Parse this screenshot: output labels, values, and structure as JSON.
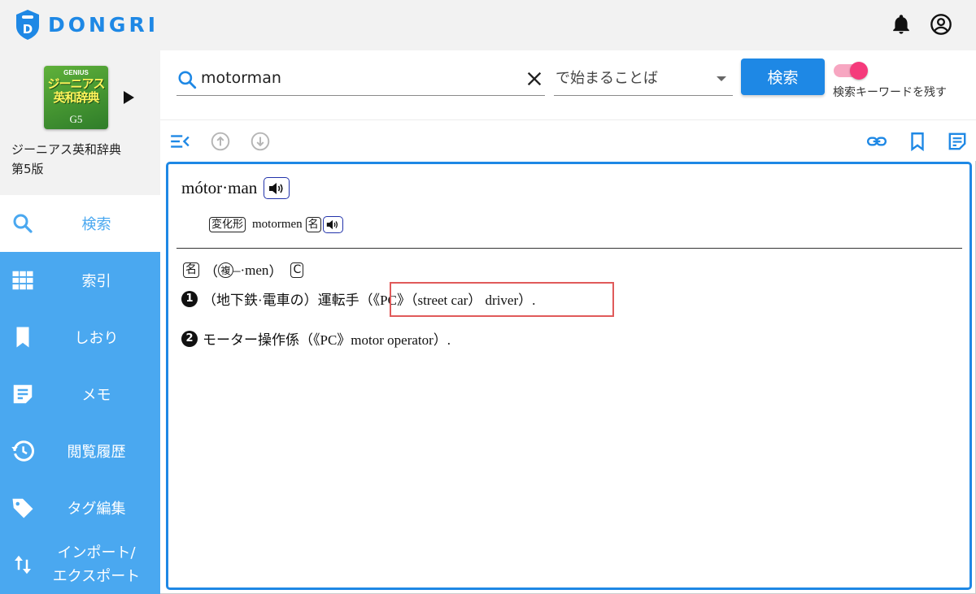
{
  "app": {
    "logo_text": "DONGRI"
  },
  "header": {
    "bell_icon": "bell-icon",
    "account_icon": "account-circle-icon"
  },
  "book": {
    "cover_brand": "GENIUS",
    "cover_title": "ジーニアス英和辞典",
    "cover_edition": "G5",
    "name_line1": "ジーニアス英和辞典",
    "name_line2": "第5版"
  },
  "sidebar": {
    "items": [
      {
        "label": "検索",
        "icon": "search-icon",
        "active": true
      },
      {
        "label": "索引",
        "icon": "grid-icon"
      },
      {
        "label": "しおり",
        "icon": "bookmark-icon"
      },
      {
        "label": "メモ",
        "icon": "memo-icon"
      },
      {
        "label": "閲覧履歴",
        "icon": "history-icon"
      },
      {
        "label": "タグ編集",
        "icon": "tag-icon"
      },
      {
        "label": "インポート/",
        "label2": "エクスポート",
        "icon": "import-export-icon"
      }
    ]
  },
  "search": {
    "query": "motorman",
    "mode": "で始まることば",
    "button_label": "検索",
    "toggle_label": "検索キーワードを残す",
    "toggle_on": true
  },
  "toolbar": {
    "left_icons": [
      "collapse-list-icon",
      "arrow-up-icon",
      "arrow-down-icon"
    ],
    "right_icons": [
      "link-icon",
      "bookmark-icon",
      "memo-icon"
    ]
  },
  "entry": {
    "headword": "mótor·man",
    "inflection_tag": "変化形",
    "inflection_word": "motormen",
    "inflection_pos": "名",
    "pos": "名",
    "plural_mark": "複",
    "plural_text": "–·men",
    "countable": "C",
    "open_paren": "（",
    "close_paren": "）",
    "senses": [
      {
        "num": "❶",
        "text_pre": "（地下鉄·電車の）運転手",
        "text_boxed": "（《PC》（street car） driver）."
      },
      {
        "num": "❷",
        "text_pre": "モーター操作係（《PC》motor operator）.",
        "text_boxed": ""
      }
    ]
  },
  "colors": {
    "primary": "#1e88e5",
    "sidebar": "#4aa8f0",
    "toggle_knob": "#f53a7b",
    "highlight": "#e05a5a"
  }
}
